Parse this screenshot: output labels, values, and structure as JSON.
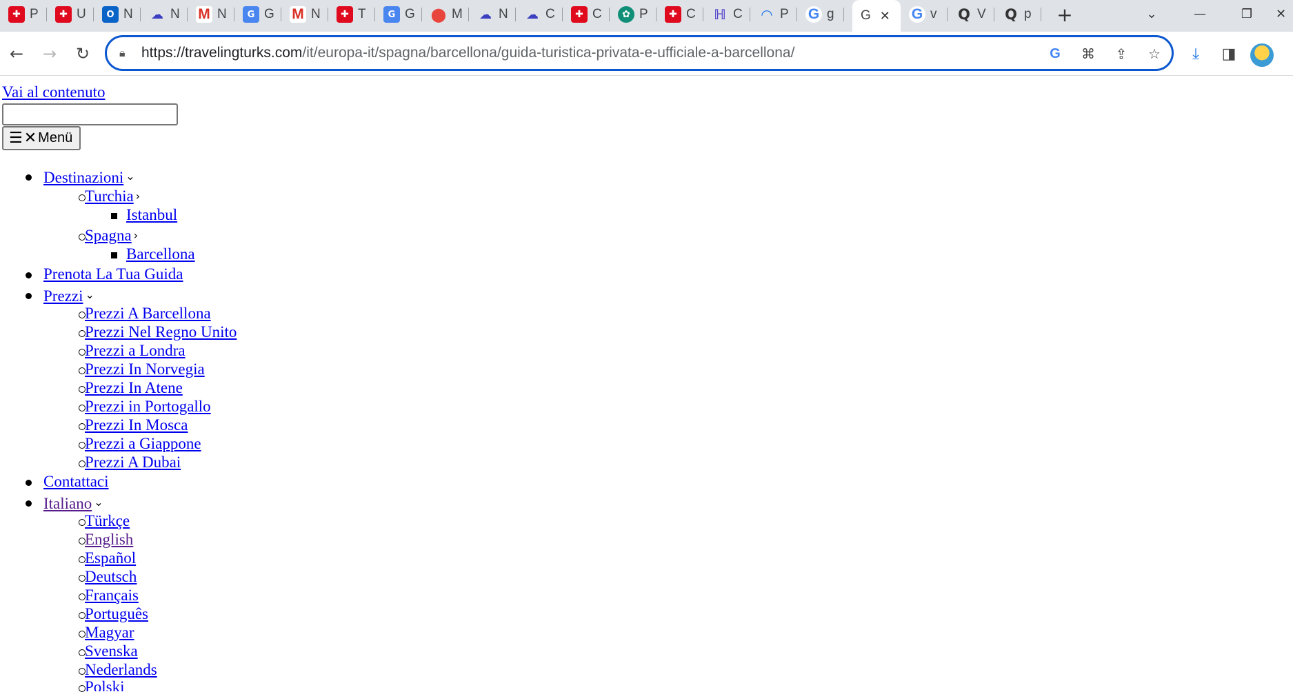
{
  "browser": {
    "tabs": [
      {
        "favicon": "red-tile-icon",
        "label": "P"
      },
      {
        "favicon": "red-tile-icon",
        "label": "U"
      },
      {
        "favicon": "outlook-icon",
        "label": "N"
      },
      {
        "favicon": "cloud-icon",
        "label": "N"
      },
      {
        "favicon": "gmail-icon",
        "label": "N"
      },
      {
        "favicon": "translate-icon",
        "label": "G"
      },
      {
        "favicon": "gmail-icon",
        "label": "N"
      },
      {
        "favicon": "red-tile-icon",
        "label": "T"
      },
      {
        "favicon": "translate-icon",
        "label": "G"
      },
      {
        "favicon": "maps-pin-icon",
        "label": "M"
      },
      {
        "favicon": "cloud-icon",
        "label": "N"
      },
      {
        "favicon": "cloud-icon",
        "label": "C"
      },
      {
        "favicon": "red-tile-icon",
        "label": "C"
      },
      {
        "favicon": "openai-icon",
        "label": "P"
      },
      {
        "favicon": "red-tile-icon",
        "label": "C"
      },
      {
        "favicon": "purple-logo-icon",
        "label": "C"
      },
      {
        "favicon": "rainbow-icon",
        "label": "P"
      },
      {
        "favicon": "google-icon",
        "label": "g"
      },
      {
        "favicon": "none",
        "label": "G",
        "active": true
      },
      {
        "favicon": "google-icon",
        "label": "v"
      },
      {
        "favicon": "q-icon",
        "label": "V"
      },
      {
        "favicon": "q-icon",
        "label": "p"
      }
    ],
    "url_host": "https://travelingturks.com",
    "url_path": "/it/europa-it/spagna/barcellona/guida-turistica-privata-e-ufficiale-a-barcellona/"
  },
  "page": {
    "skip_link": "Vai al contenuto",
    "search_value": "",
    "menu_button": "Menü",
    "nav": {
      "destinazioni": "Destinazioni",
      "turchia": "Turchia",
      "istanbul": "Istanbul",
      "spagna": "Spagna",
      "barcellona": "Barcellona",
      "prenota": "Prenota La Tua Guida",
      "prezzi": "Prezzi",
      "prezzi_items": [
        "Prezzi A Barcellona",
        "Prezzi Nel Regno Unito",
        "Prezzi a Londra",
        "Prezzi In Norvegia",
        "Prezzi In Atene",
        "Prezzi in Portogallo",
        "Prezzi In Mosca",
        "Prezzi a Giappone",
        "Prezzi A Dubai"
      ],
      "contattaci": "Contattaci",
      "italiano": "Italiano",
      "languages": [
        "Türkçe",
        "English",
        "Español",
        "Deutsch",
        "Français",
        "Português",
        "Magyar",
        "Svenska",
        "Nederlands",
        "Polski"
      ]
    }
  }
}
